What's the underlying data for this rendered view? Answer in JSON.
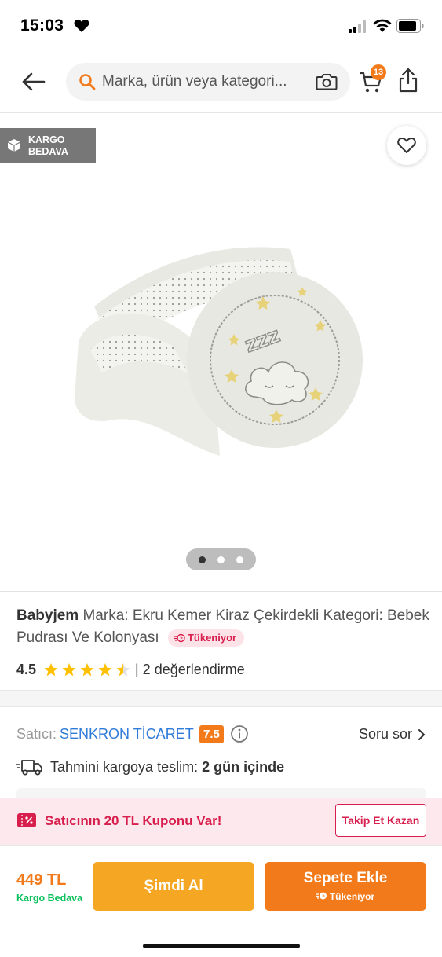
{
  "status_bar": {
    "time": "15:03"
  },
  "header": {
    "search_placeholder": "Marka, ürün veya kategori...",
    "cart_count": "13"
  },
  "gallery": {
    "badge_line1": "KARGO",
    "badge_line2": "BEDAVA",
    "dots": [
      true,
      false,
      false
    ]
  },
  "product": {
    "brand": "Babyjem",
    "title": "Marka: Ekru Kemer Kiraz Çekirdekli Kategori: Bebek Pudrası Ve Kolonyası",
    "stock_badge": "Tükeniyor",
    "rating": "4.5",
    "rating_value": 4.5,
    "review_count": "| 2 değerlendirme"
  },
  "seller": {
    "label": "Satıcı:",
    "name": "SENKRON TİCARET",
    "score": "7.5",
    "ask": "Soru sor"
  },
  "delivery": {
    "text": "Tahmini kargoya teslim:",
    "value": "2 gün içinde"
  },
  "coupon": {
    "text": "Satıcının 20 TL Kuponu Var!",
    "button": "Takip Et Kazan"
  },
  "bottom": {
    "price": "449 TL",
    "shipping": "Kargo Bedava",
    "buy_now": "Şimdi Al",
    "add_to_cart": "Sepete Ekle",
    "add_sub": "Tükeniyor"
  },
  "colors": {
    "accent": "#f27a1a",
    "buy": "#f5a623",
    "pink": "#d81e4c",
    "seller_link": "#2e7bd9",
    "free_shipping": "#0bc15c"
  }
}
